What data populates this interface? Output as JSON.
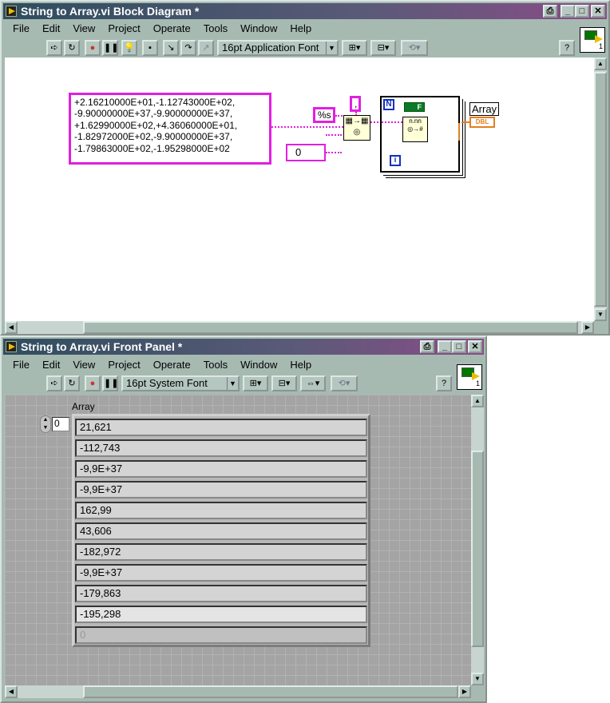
{
  "block_diagram": {
    "title": "String to Array.vi Block Diagram *",
    "menu": [
      "File",
      "Edit",
      "View",
      "Project",
      "Operate",
      "Tools",
      "Window",
      "Help"
    ],
    "font_select": "16pt Application Font",
    "help": "?",
    "icon_number": "1",
    "string_constant": "+2.16210000E+01,-1.12743000E+02,\n-9.90000000E+37,-9.90000000E+37,\n+1.62990000E+02,+4.36060000E+01,\n-1.82972000E+02,-9.90000000E+37,\n-1.79863000E+02,-1.95298000E+02",
    "format_constant": "%s",
    "delimiter_constant": ",",
    "offset_constant": "0",
    "loop_count_label": "N",
    "loop_index_label": "i",
    "bool_constant": "F",
    "scan_node_label": "n.nn",
    "indicator_label": "Array",
    "indicator_type": "DBL"
  },
  "front_panel": {
    "title": "String to Array.vi Front Panel *",
    "menu": [
      "File",
      "Edit",
      "View",
      "Project",
      "Operate",
      "Tools",
      "Window",
      "Help"
    ],
    "font_select": "16pt System Font",
    "help": "?",
    "icon_number": "1",
    "array_label": "Array",
    "index_value": "0",
    "elements": [
      "21,621",
      "-112,743",
      "-9,9E+37",
      "-9,9E+37",
      "162,99",
      "43,606",
      "-182,972",
      "-9,9E+37",
      "-179,863",
      "-195,298",
      "0"
    ]
  }
}
